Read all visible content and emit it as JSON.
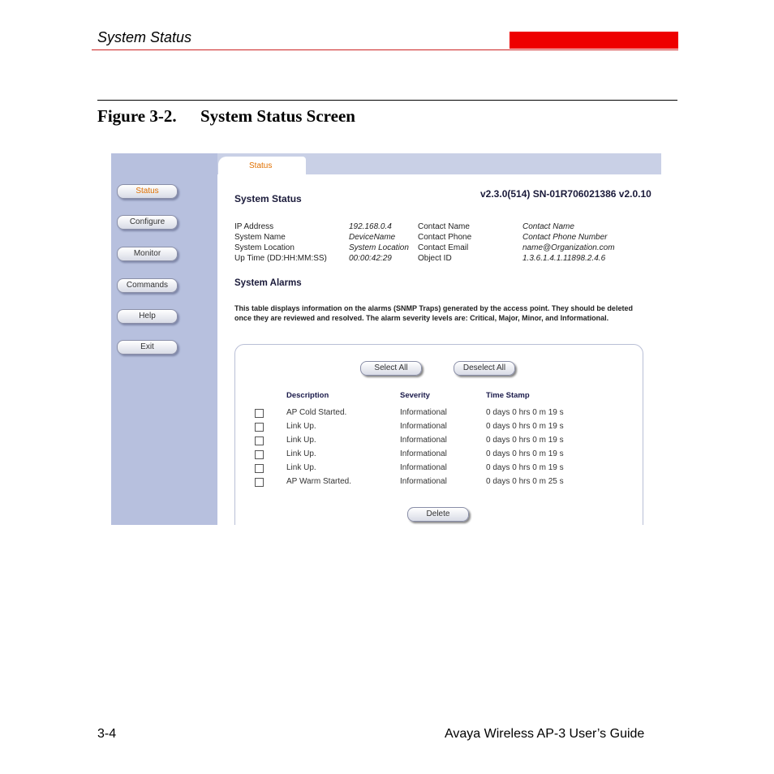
{
  "page": {
    "header_title": "System Status",
    "figure_number": "Figure 3-2.",
    "figure_title": "System Status Screen",
    "footer_left": "3-4",
    "footer_right": "Avaya Wireless AP-3 User’s Guide",
    "accent_color": "#ee0000"
  },
  "screenshot": {
    "tab": "Status",
    "nav": [
      "Status",
      "Configure",
      "Monitor",
      "Commands",
      "Help",
      "Exit"
    ],
    "section_title": "System Status",
    "version": "v2.3.0(514) SN-01R706021386 v2.0.10",
    "info": {
      "ip_label": "IP Address",
      "ip_value": "192.168.0.4",
      "name_label": "System Name",
      "name_value": "DeviceName",
      "location_label": "System Location",
      "location_value": "System Location",
      "uptime_label": "Up Time (DD:HH:MM:SS)",
      "uptime_value": "00:00:42:29",
      "contact_name_label": "Contact Name",
      "contact_name_value": "Contact Name",
      "contact_phone_label": "Contact Phone",
      "contact_phone_value": "Contact Phone Number",
      "contact_email_label": "Contact Email",
      "contact_email_value": "name@Organization.com",
      "object_id_label": "Object ID",
      "object_id_value": "1.3.6.1.4.1.11898.2.4.6"
    },
    "alarms_title": "System Alarms",
    "alarms_note": "This table displays information on the alarms (SNMP Traps) generated by the access point. They should be deleted once they are reviewed and resolved. The alarm severity levels are: Critical, Major, Minor, and Informational.",
    "select_all": "Select All",
    "deselect_all": "Deselect All",
    "delete": "Delete",
    "columns": [
      "Description",
      "Severity",
      "Time Stamp"
    ],
    "rows": [
      {
        "description": "AP Cold Started.",
        "severity": "Informational",
        "time": "0 days 0 hrs 0 m 19 s"
      },
      {
        "description": "Link Up.",
        "severity": "Informational",
        "time": "0 days 0 hrs 0 m 19 s"
      },
      {
        "description": "Link Up.",
        "severity": "Informational",
        "time": "0 days 0 hrs 0 m 19 s"
      },
      {
        "description": "Link Up.",
        "severity": "Informational",
        "time": "0 days 0 hrs 0 m 19 s"
      },
      {
        "description": "Link Up.",
        "severity": "Informational",
        "time": "0 days 0 hrs 0 m 19 s"
      },
      {
        "description": "AP Warm Started.",
        "severity": "Informational",
        "time": "0 days 0 hrs 0 m 25 s"
      }
    ]
  }
}
